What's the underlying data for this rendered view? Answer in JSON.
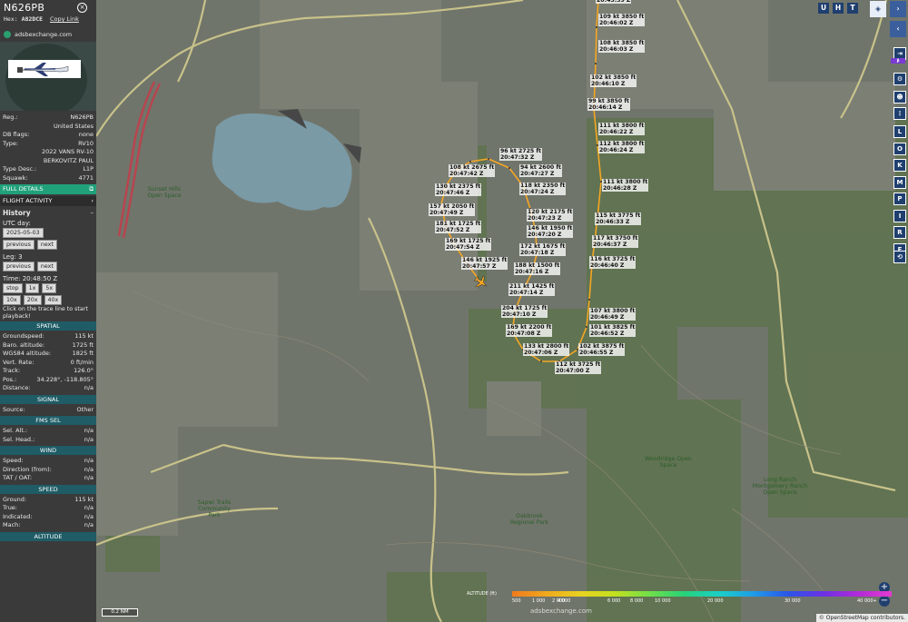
{
  "aircraft": {
    "callsign": "N626PB",
    "hex_label": "Hex:",
    "hex": "A82DCE",
    "copy_link": "Copy Link",
    "site": "adsbexchange.com"
  },
  "info": [
    {
      "k": "Reg.:",
      "v": "N626PB"
    },
    {
      "k": "",
      "v": "United States"
    },
    {
      "k": "DB flags:",
      "v": "none"
    },
    {
      "k": "Type:",
      "v": "RV10"
    },
    {
      "k": "",
      "v": "2022 VANS RV-10"
    },
    {
      "k": "",
      "v": "BERKOVITZ PAUL"
    },
    {
      "k": "Type Desc.:",
      "v": "L1P"
    },
    {
      "k": "Squawk:",
      "v": "4771"
    }
  ],
  "buttons": {
    "full_details": "FULL DETAILS",
    "flight_activity": "FLIGHT ACTIVITY"
  },
  "history": {
    "title": "History",
    "utc_label": "UTC day:",
    "utc_value": "2025-05-03",
    "previous": "previous",
    "next": "next",
    "leg_label": "Leg: 3",
    "time_label": "Time: 20:48:50 Z",
    "speeds": [
      "stop",
      "1x",
      "5x",
      "10x",
      "20x",
      "40x"
    ],
    "hint": "Click on the trace line to start playback!"
  },
  "spatial": {
    "title": "SPATIAL",
    "rows": [
      {
        "k": "Groundspeed:",
        "v": "115 kt"
      },
      {
        "k": "Baro. altitude:",
        "v": "1725 ft"
      },
      {
        "k": "WGS84 altitude:",
        "v": "1825 ft"
      },
      {
        "k": "Vert. Rate:",
        "v": "0 ft/min"
      },
      {
        "k": "Track:",
        "v": "126.0°"
      },
      {
        "k": "Pos.:",
        "v": "34.228°, -118.805°"
      },
      {
        "k": "Distance:",
        "v": "n/a"
      }
    ]
  },
  "signal": {
    "title": "SIGNAL",
    "rows": [
      {
        "k": "Source:",
        "v": "Other"
      }
    ]
  },
  "fms": {
    "title": "FMS SEL",
    "rows": [
      {
        "k": "Sel. Alt.:",
        "v": "n/a"
      },
      {
        "k": "Sel. Head.:",
        "v": "n/a"
      }
    ]
  },
  "wind": {
    "title": "WIND",
    "rows": [
      {
        "k": "Speed:",
        "v": "n/a"
      },
      {
        "k": "Direction (from):",
        "v": "n/a"
      },
      {
        "k": "TAT / OAT:",
        "v": "n/a"
      }
    ]
  },
  "speed": {
    "title": "SPEED",
    "rows": [
      {
        "k": "Ground:",
        "v": "115 kt"
      },
      {
        "k": "True:",
        "v": "n/a"
      },
      {
        "k": "Indicated:",
        "v": "n/a"
      },
      {
        "k": "Mach:",
        "v": "n/a"
      }
    ]
  },
  "altitude": {
    "title": "ALTITUDE"
  },
  "trace_labels": [
    "109 kt 3850 ft|20:46:02 Z",
    "108 kt 3850 ft|20:46:03 Z",
    "102 kt 3850 ft|20:46:10 Z",
    "99 kt 3850 ft|20:46:14 Z",
    "111 kt 3800 ft|20:46:22 Z",
    "112 kt 3800 ft|20:46:24 Z",
    "111 kt 3800 ft|20:46:28 Z",
    "115 kt 3775 ft|20:46:33 Z",
    "117 kt 3750 ft|20:46:37 Z",
    "116 kt 3725 ft|20:46:40 Z",
    "107 kt 3800 ft|20:46:49 Z",
    "101 kt 3825 ft|20:46:52 Z",
    "102 kt 3875 ft|20:46:55 Z",
    "112 kt 3725 ft|20:47:00 Z",
    "133 kt 2800 ft|20:47:06 Z",
    "169 kt 2200 ft|20:47:08 Z",
    "204 kt 1725 ft|20:47:10 Z",
    "211 kt 1425 ft|20:47:14 Z",
    "188 kt 1500 ft|20:47:16 Z",
    "172 kt 1675 ft|20:47:18 Z",
    "146 kt 1950 ft|20:47:20 Z",
    "120 kt 2175 ft|20:47:23 Z",
    "118 kt 2350 ft|20:47:24 Z",
    "94 kt 2600 ft|20:47:27 Z",
    "96 kt 2725 ft|20:47:32 Z",
    "108 kt 2675 ft|20:47:42 Z",
    "130 kt 2375 ft|20:47:46 Z",
    "157 kt 2050 ft|20:47:49 Z",
    "181 kt 1725 ft|20:47:52 Z",
    "169 kt 1725 ft|20:47:54 Z",
    "146 kt 1925 ft|20:47:57 Z",
    "|20:45:59 Z"
  ],
  "places": [
    "Sunset Hills Open Space",
    "Woodridge Open Space",
    "Oakbrook Regional Park",
    "Long Ranch Montgomery Ranch Open Space",
    "Sapwi Trails Community Park"
  ],
  "toolbar_top": [
    "U",
    "H",
    "T"
  ],
  "right_buttons": [
    "L",
    "O",
    "K",
    "M",
    "P",
    "I",
    "R",
    "F"
  ],
  "legend": {
    "title": "ALTITUDE (ft)",
    "ticks": [
      "500",
      "1 000",
      "2 000",
      "4 000",
      "6 000",
      "8 000",
      "10 000",
      "20 000",
      "30 000",
      "40 000+"
    ]
  },
  "scale_label": "0.2 NM",
  "attribution": {
    "text": "© OpenStreetMap contributors.",
    "link": "OpenStreetMap"
  },
  "watermark": "adsbexchange.com",
  "colors": {
    "sidebar": "#3a3a3a",
    "accent": "#21a179",
    "band": "#1f5c66",
    "trace": "#f5a623",
    "button": "#1f3f6e"
  }
}
